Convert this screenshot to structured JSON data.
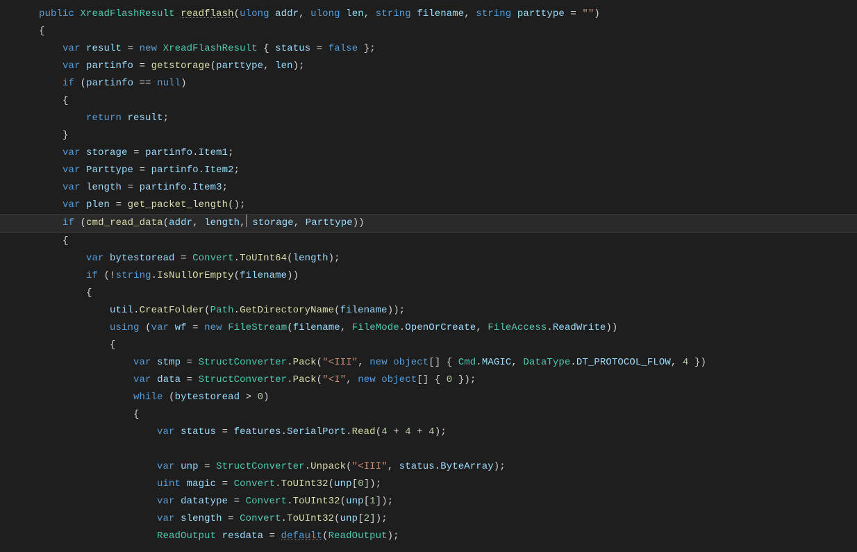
{
  "code": {
    "method": {
      "access": "public",
      "return_type": "XreadFlashResult",
      "name": "readflash",
      "params": [
        {
          "type": "ulong",
          "name": "addr"
        },
        {
          "type": "ulong",
          "name": "len"
        },
        {
          "type": "string",
          "name": "filename"
        },
        {
          "type": "string",
          "name": "parttype",
          "default": "\"\""
        }
      ]
    },
    "tokens": {
      "kw_public": "public",
      "kw_var": "var",
      "kw_new": "new",
      "kw_if": "if",
      "kw_null": "null",
      "kw_return": "return",
      "kw_false": "false",
      "kw_using": "using",
      "kw_while": "while",
      "kw_default": "default",
      "kw_uint": "uint",
      "t_ulong": "ulong",
      "t_string": "string",
      "t_object": "object",
      "t_XreadFlashResult": "XreadFlashResult",
      "t_Convert": "Convert",
      "t_Path": "Path",
      "t_FileStream": "FileStream",
      "t_FileMode": "FileMode",
      "t_FileAccess": "FileAccess",
      "t_StructConverter": "StructConverter",
      "t_Cmd": "Cmd",
      "t_DataType": "DataType",
      "t_ReadOutput": "ReadOutput",
      "fn_readflash": "readflash",
      "fn_getstorage": "getstorage",
      "fn_get_packet_length": "get_packet_length",
      "fn_cmd_read_data": "cmd_read_data",
      "fn_ToUInt64": "ToUInt64",
      "fn_ToUInt32": "ToUInt32",
      "fn_IsNullOrEmpty": "IsNullOrEmpty",
      "fn_CreatFolder": "CreatFolder",
      "fn_GetDirectoryName": "GetDirectoryName",
      "fn_Pack": "Pack",
      "fn_Unpack": "Unpack",
      "fn_Read": "Read",
      "id_addr": "addr",
      "id_len": "len",
      "id_filename": "filename",
      "id_parttype": "parttype",
      "id_result": "result",
      "id_status": "status",
      "id_partinfo": "partinfo",
      "id_storage": "storage",
      "id_Parttype": "Parttype",
      "id_length": "length",
      "id_plen": "plen",
      "id_bytestoread": "bytestoread",
      "id_util": "util",
      "id_wf": "wf",
      "id_stmp": "stmp",
      "id_data": "data",
      "id_features": "features",
      "id_unp": "unp",
      "id_magic": "magic",
      "id_datatype": "datatype",
      "id_slength": "slength",
      "id_resdata": "resdata",
      "id_Item1": "Item1",
      "id_Item2": "Item2",
      "id_Item3": "Item3",
      "id_OpenOrCreate": "OpenOrCreate",
      "id_ReadWrite": "ReadWrite",
      "id_MAGIC": "MAGIC",
      "id_DT_PROTOCOL_FLOW": "DT_PROTOCOL_FLOW",
      "id_SerialPort": "SerialPort",
      "id_ByteArray": "ByteArray",
      "str_empty": "\"\"",
      "str_III": "\"<III\"",
      "str_I": "\"<I\"",
      "num_0": "0",
      "num_1": "1",
      "num_2": "2",
      "num_4": "4",
      "expr_444": "4 + 4 + 4"
    }
  }
}
